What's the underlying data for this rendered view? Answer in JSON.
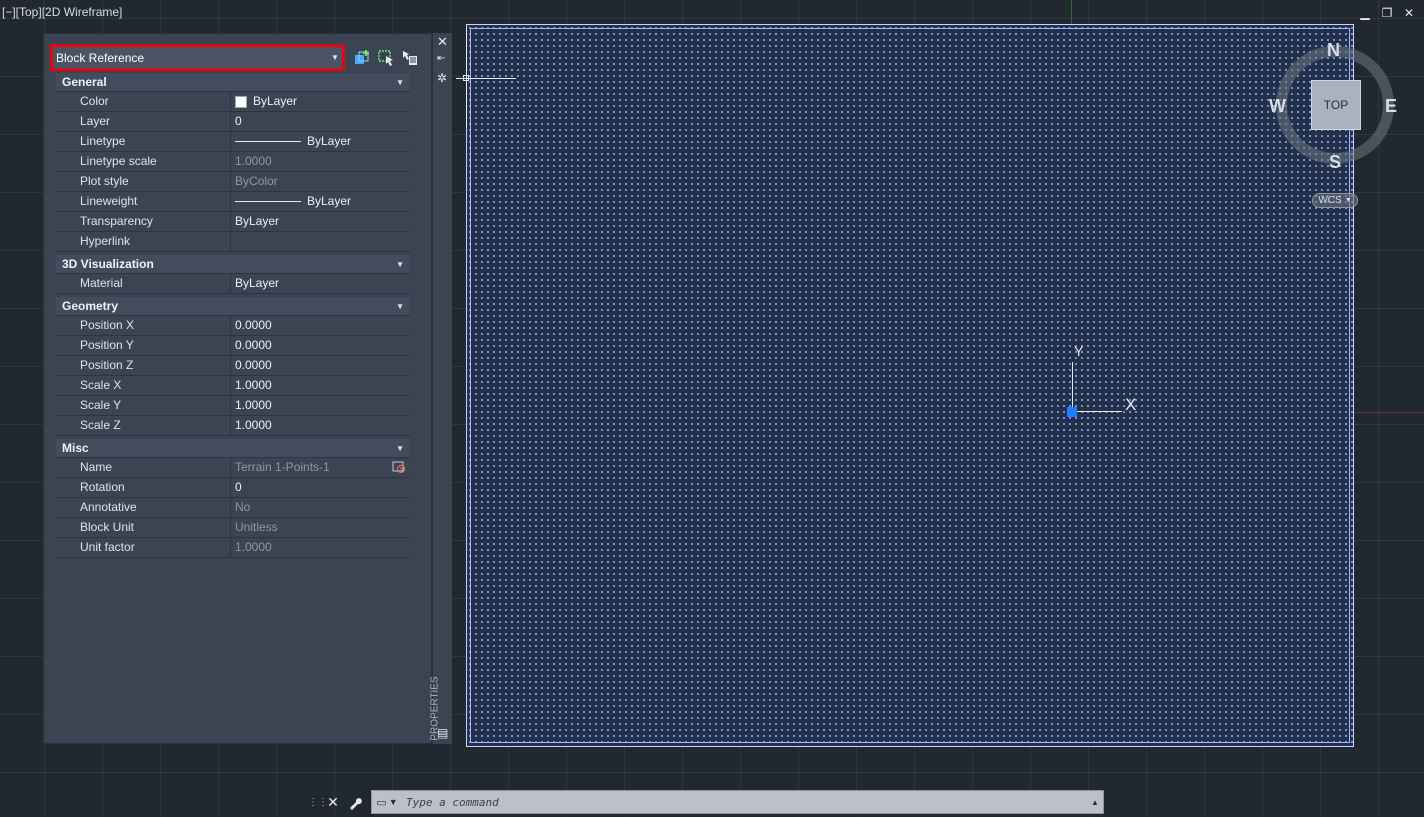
{
  "viewport": {
    "label": "[−][Top][2D Wireframe]"
  },
  "window_controls": {
    "minimize": "▁",
    "restore": "❐",
    "close": "✕"
  },
  "properties": {
    "palette_title": "PROPERTIES",
    "selector": {
      "value": "Block Reference"
    },
    "sections": [
      {
        "title": "General",
        "rows": [
          {
            "key": "Color",
            "value": "ByLayer",
            "kind": "swatch"
          },
          {
            "key": "Layer",
            "value": "0"
          },
          {
            "key": "Linetype",
            "value": "ByLayer",
            "kind": "line"
          },
          {
            "key": "Linetype scale",
            "value": "1.0000",
            "dim": true
          },
          {
            "key": "Plot style",
            "value": "ByColor",
            "dim": true
          },
          {
            "key": "Lineweight",
            "value": "ByLayer",
            "kind": "line"
          },
          {
            "key": "Transparency",
            "value": "ByLayer"
          },
          {
            "key": "Hyperlink",
            "value": ""
          }
        ]
      },
      {
        "title": "3D Visualization",
        "rows": [
          {
            "key": "Material",
            "value": "ByLayer"
          }
        ]
      },
      {
        "title": "Geometry",
        "rows": [
          {
            "key": "Position X",
            "value": "0.0000"
          },
          {
            "key": "Position Y",
            "value": "0.0000"
          },
          {
            "key": "Position Z",
            "value": "0.0000"
          },
          {
            "key": "Scale X",
            "value": "1.0000"
          },
          {
            "key": "Scale Y",
            "value": "1.0000"
          },
          {
            "key": "Scale Z",
            "value": "1.0000"
          }
        ]
      },
      {
        "title": "Misc",
        "rows": [
          {
            "key": "Name",
            "value": "Terrain 1-Points-1",
            "dim": true,
            "kind": "pick"
          },
          {
            "key": "Rotation",
            "value": "0"
          },
          {
            "key": "Annotative",
            "value": "No",
            "dim": true
          },
          {
            "key": "Block Unit",
            "value": "Unitless",
            "dim": true
          },
          {
            "key": "Unit factor",
            "value": "1.0000",
            "dim": true
          }
        ]
      }
    ]
  },
  "viewcube": {
    "top_face": "TOP",
    "north": "N",
    "south": "S",
    "east": "E",
    "west": "W",
    "wcs_label": "WCS"
  },
  "ucs": {
    "x_label": "X",
    "y_label": "Y"
  },
  "command_line": {
    "placeholder": "Type a command"
  },
  "colors": {
    "highlight_border": "#e30613",
    "ucs_origin": "#1e7cff",
    "points": "#7fa3ff"
  }
}
